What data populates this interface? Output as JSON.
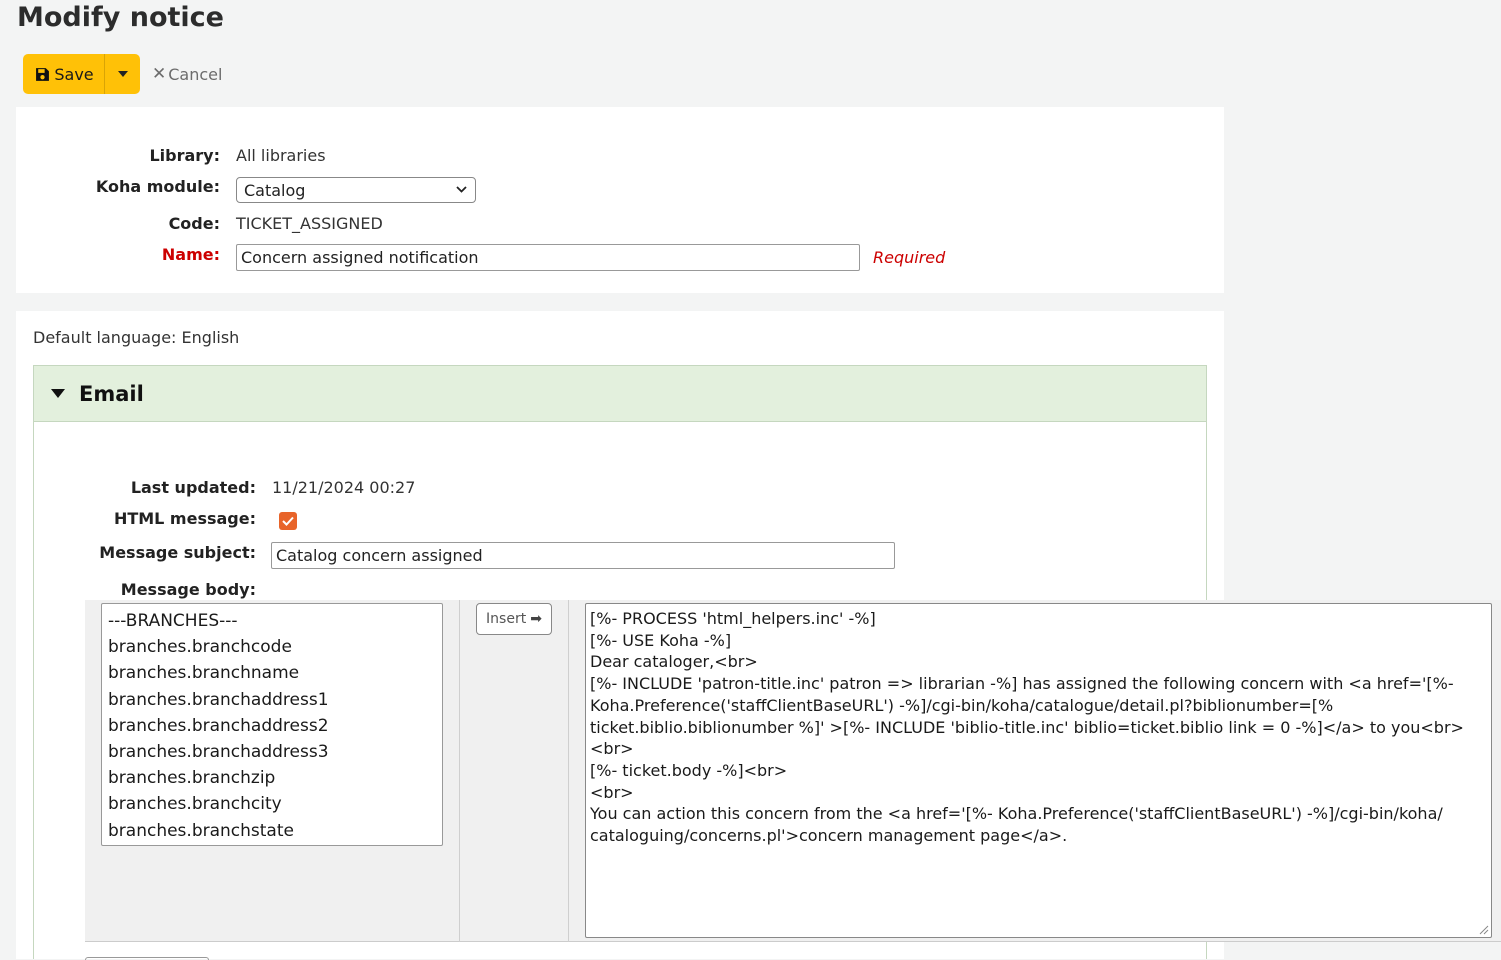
{
  "page": {
    "title": "Modify notice"
  },
  "toolbar": {
    "save_label": "Save",
    "cancel_label": "Cancel"
  },
  "form": {
    "library_label": "Library:",
    "library_value": "All libraries",
    "module_label": "Koha module:",
    "module_value": "Catalog",
    "code_label": "Code:",
    "code_value": "TICKET_ASSIGNED",
    "name_label": "Name:",
    "name_value": "Concern assigned notification",
    "required_text": "Required"
  },
  "language": {
    "label": "Default language:",
    "value": "English"
  },
  "email": {
    "section_title": "Email",
    "last_updated_label": "Last updated:",
    "last_updated_value": "11/21/2024 00:27",
    "html_label": "HTML message:",
    "html_checked": true,
    "subject_label": "Message subject:",
    "subject_value": "Catalog concern assigned",
    "body_label": "Message body:",
    "insert_label": "Insert",
    "fields": [
      "---BRANCHES---",
      "branches.branchcode",
      "branches.branchname",
      "branches.branchaddress1",
      "branches.branchaddress2",
      "branches.branchaddress3",
      "branches.branchzip",
      "branches.branchcity",
      "branches.branchstate"
    ],
    "body_lines": [
      "[%- PROCESS 'html_helpers.inc' -%]",
      "[%- USE Koha -%]",
      "Dear cataloger,<br>",
      "[%- INCLUDE 'patron-title.inc' patron => librarian -%] has assigned the following concern with <a href='[%-",
      "Koha.Preference('staffClientBaseURL') -%]/cgi-bin/koha/catalogue/detail.pl?biblionumber=[%",
      "ticket.biblio.biblionumber %]' >[%- INCLUDE 'biblio-title.inc' biblio=ticket.biblio link = 0 -%]</a> to you<br>",
      "<br>",
      "[%- ticket.body -%]<br>",
      "<br>",
      "You can action this concern from the <a href='[%- Koha.Preference('staffClientBaseURL') -%]/cgi-bin/koha/",
      "cataloguing/concerns.pl'>concern management page</a>."
    ]
  },
  "colors": {
    "save_button": "#ffc107",
    "section_header": "#e3f0dd",
    "required": "#cc0000",
    "checkbox": "#e8642a"
  },
  "icons": {
    "save": "floppy-disk-icon",
    "cancel": "close-icon",
    "dropdown": "chevron-down-icon",
    "insert": "arrow-right-icon"
  }
}
